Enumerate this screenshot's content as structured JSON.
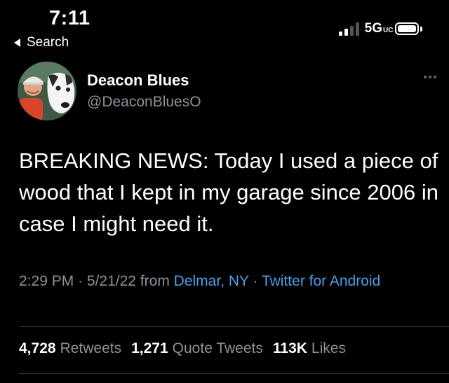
{
  "status_bar": {
    "time": "7:11",
    "back_label": "Search",
    "network": "5G",
    "network_suffix": "UC"
  },
  "tweet": {
    "author": {
      "name": "Deacon Blues",
      "handle": "@DeaconBluesO"
    },
    "text": "BREAKING NEWS: Today I used a piece of wood that I kept in my garage since 2006 in case I might need it.",
    "time": "2:29 PM",
    "date": "5/21/22",
    "from_label": "from",
    "location": "Delmar, NY",
    "source": "Twitter for Android",
    "separator": "·",
    "stats": [
      {
        "count": "4,728",
        "label": "Retweets"
      },
      {
        "count": "1,271",
        "label": "Quote Tweets"
      },
      {
        "count": "113K",
        "label": "Likes"
      }
    ]
  },
  "colors": {
    "background": "#000000",
    "link": "#4c9fe6",
    "muted": "#8b9299",
    "text": "#ffffff"
  },
  "icons": {
    "back": "back-arrow-icon",
    "signal": "signal-icon",
    "battery": "battery-icon",
    "more": "more-horizontal-icon"
  }
}
